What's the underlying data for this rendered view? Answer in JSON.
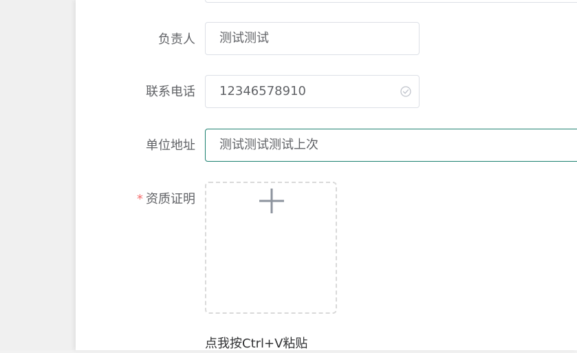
{
  "form": {
    "person_in_charge": {
      "label": "负责人",
      "value": "测试测试"
    },
    "phone": {
      "label": "联系电话",
      "value": "12346578910",
      "status_icon": "circle-check-icon"
    },
    "address": {
      "label": "单位地址",
      "value": "测试测试测试上次"
    },
    "qualification": {
      "required_mark": "*",
      "label": "资质证明",
      "upload_icon": "plus-icon",
      "paste_hint": "点我按Ctrl+V粘贴"
    }
  },
  "colors": {
    "focus_border": "#1a7f6e",
    "required": "#f56c6c",
    "label_text": "#606266",
    "border": "#dcdfe6"
  }
}
